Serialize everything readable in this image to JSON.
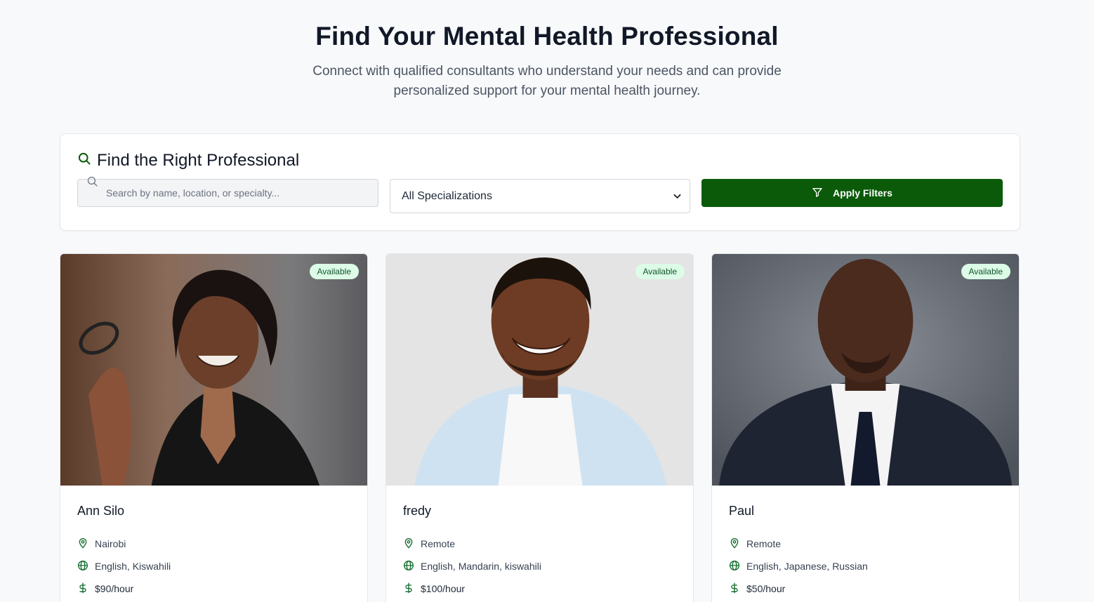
{
  "hero": {
    "title": "Find Your Mental Health Professional",
    "subtitle": "Connect with qualified consultants who understand your needs and can provide personalized support for your mental health journey."
  },
  "filters": {
    "title": "Find the Right Professional",
    "search_placeholder": "Search by name, location, or specialty...",
    "specialization_selected": "All Specializations",
    "apply_label": "Apply Filters"
  },
  "colors": {
    "accent": "#0a5a0a",
    "badge_bg": "#dcfce7",
    "icon_green": "#0f6b2a"
  },
  "consultants": [
    {
      "name": "Ann Silo",
      "status": "Available",
      "location": "Nairobi",
      "languages": "English, Kiswahili",
      "rate": "$90/hour",
      "icons": [
        "map-pin-icon",
        "globe-icon",
        "dollar-icon"
      ]
    },
    {
      "name": "fredy",
      "status": "Available",
      "location": "Remote",
      "languages": "English, Mandarin, kiswahili",
      "rate": "$100/hour",
      "icons": [
        "map-pin-icon",
        "globe-icon",
        "dollar-icon"
      ]
    },
    {
      "name": "Paul",
      "status": "Available",
      "location": "Remote",
      "languages": "English, Japanese, Russian",
      "rate": "$50/hour",
      "icons": [
        "map-pin-icon",
        "globe-icon",
        "dollar-icon"
      ]
    }
  ]
}
